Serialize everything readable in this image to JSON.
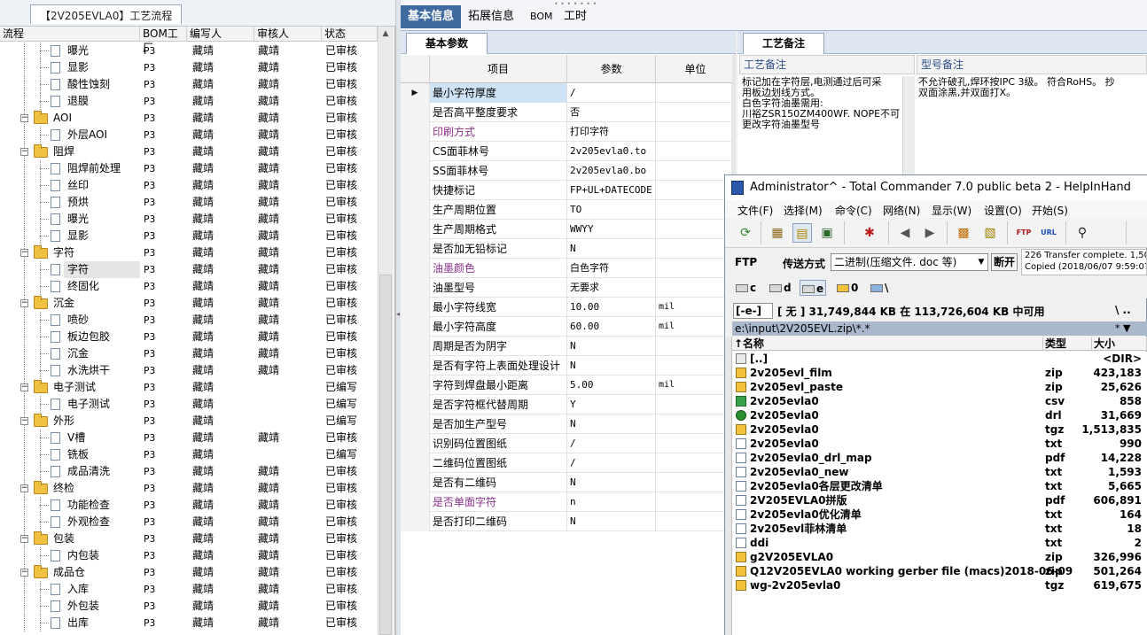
{
  "left": {
    "title": "【2V205EVLA0】工艺流程",
    "columns": [
      "流程",
      "BOM工厂",
      "编写人",
      "审核人",
      "状态"
    ],
    "rows": [
      {
        "name": "曝光",
        "level": 2,
        "kind": "doc",
        "bom": "P3",
        "editor": "藏靖",
        "reviewer": "藏靖",
        "status": "已审核"
      },
      {
        "name": "显影",
        "level": 2,
        "kind": "doc",
        "bom": "P3",
        "editor": "藏靖",
        "reviewer": "藏靖",
        "status": "已审核"
      },
      {
        "name": "酸性蚀刻",
        "level": 2,
        "kind": "doc",
        "bom": "P3",
        "editor": "藏靖",
        "reviewer": "藏靖",
        "status": "已审核"
      },
      {
        "name": "退膜",
        "level": 2,
        "kind": "doc",
        "bom": "P3",
        "editor": "藏靖",
        "reviewer": "藏靖",
        "status": "已审核"
      },
      {
        "name": "AOI",
        "level": 1,
        "kind": "folder",
        "bom": "P3",
        "editor": "藏靖",
        "reviewer": "藏靖",
        "status": "已审核"
      },
      {
        "name": "外层AOI",
        "level": 2,
        "kind": "doc",
        "bom": "P3",
        "editor": "藏靖",
        "reviewer": "藏靖",
        "status": "已审核"
      },
      {
        "name": "阻焊",
        "level": 1,
        "kind": "folder",
        "bom": "P3",
        "editor": "藏靖",
        "reviewer": "藏靖",
        "status": "已审核"
      },
      {
        "name": "阻焊前处理",
        "level": 2,
        "kind": "doc",
        "bom": "P3",
        "editor": "藏靖",
        "reviewer": "藏靖",
        "status": "已审核"
      },
      {
        "name": "丝印",
        "level": 2,
        "kind": "doc",
        "bom": "P3",
        "editor": "藏靖",
        "reviewer": "藏靖",
        "status": "已审核"
      },
      {
        "name": "预烘",
        "level": 2,
        "kind": "doc",
        "bom": "P3",
        "editor": "藏靖",
        "reviewer": "藏靖",
        "status": "已审核"
      },
      {
        "name": "曝光",
        "level": 2,
        "kind": "doc",
        "bom": "P3",
        "editor": "藏靖",
        "reviewer": "藏靖",
        "status": "已审核"
      },
      {
        "name": "显影",
        "level": 2,
        "kind": "doc",
        "bom": "P3",
        "editor": "藏靖",
        "reviewer": "藏靖",
        "status": "已审核"
      },
      {
        "name": "字符",
        "level": 1,
        "kind": "folder",
        "bom": "P3",
        "editor": "藏靖",
        "reviewer": "藏靖",
        "status": "已审核"
      },
      {
        "name": "字符",
        "level": 2,
        "kind": "doc",
        "bom": "P3",
        "editor": "藏靖",
        "reviewer": "藏靖",
        "status": "已审核",
        "selected": true
      },
      {
        "name": "终固化",
        "level": 2,
        "kind": "doc",
        "bom": "P3",
        "editor": "藏靖",
        "reviewer": "藏靖",
        "status": "已审核"
      },
      {
        "name": "沉金",
        "level": 1,
        "kind": "folder",
        "bom": "P3",
        "editor": "藏靖",
        "reviewer": "藏靖",
        "status": "已审核"
      },
      {
        "name": "喷砂",
        "level": 2,
        "kind": "doc",
        "bom": "P3",
        "editor": "藏靖",
        "reviewer": "藏靖",
        "status": "已审核"
      },
      {
        "name": "板边包胶",
        "level": 2,
        "kind": "doc",
        "bom": "P3",
        "editor": "藏靖",
        "reviewer": "藏靖",
        "status": "已审核"
      },
      {
        "name": "沉金",
        "level": 2,
        "kind": "doc",
        "bom": "P3",
        "editor": "藏靖",
        "reviewer": "藏靖",
        "status": "已审核"
      },
      {
        "name": "水洗烘干",
        "level": 2,
        "kind": "doc",
        "bom": "P3",
        "editor": "藏靖",
        "reviewer": "藏靖",
        "status": "已审核"
      },
      {
        "name": "电子测试",
        "level": 1,
        "kind": "folder",
        "bom": "P3",
        "editor": "藏靖",
        "reviewer": "",
        "status": "已编写"
      },
      {
        "name": "电子测试",
        "level": 2,
        "kind": "doc",
        "bom": "P3",
        "editor": "藏靖",
        "reviewer": "",
        "status": "已编写"
      },
      {
        "name": "外形",
        "level": 1,
        "kind": "folder",
        "bom": "P3",
        "editor": "藏靖",
        "reviewer": "",
        "status": "已编写"
      },
      {
        "name": "V槽",
        "level": 2,
        "kind": "doc",
        "bom": "P3",
        "editor": "藏靖",
        "reviewer": "藏靖",
        "status": "已审核"
      },
      {
        "name": "铣板",
        "level": 2,
        "kind": "doc",
        "bom": "P3",
        "editor": "藏靖",
        "reviewer": "",
        "status": "已编写"
      },
      {
        "name": "成品清洗",
        "level": 2,
        "kind": "doc",
        "bom": "P3",
        "editor": "藏靖",
        "reviewer": "藏靖",
        "status": "已审核"
      },
      {
        "name": "终检",
        "level": 1,
        "kind": "folder",
        "bom": "P3",
        "editor": "藏靖",
        "reviewer": "藏靖",
        "status": "已审核"
      },
      {
        "name": "功能检查",
        "level": 2,
        "kind": "doc",
        "bom": "P3",
        "editor": "藏靖",
        "reviewer": "藏靖",
        "status": "已审核"
      },
      {
        "name": "外观检查",
        "level": 2,
        "kind": "doc",
        "bom": "P3",
        "editor": "藏靖",
        "reviewer": "藏靖",
        "status": "已审核"
      },
      {
        "name": "包装",
        "level": 1,
        "kind": "folder",
        "bom": "P3",
        "editor": "藏靖",
        "reviewer": "藏靖",
        "status": "已审核"
      },
      {
        "name": "内包装",
        "level": 2,
        "kind": "doc",
        "bom": "P3",
        "editor": "藏靖",
        "reviewer": "藏靖",
        "status": "已审核"
      },
      {
        "name": "成品仓",
        "level": 1,
        "kind": "folder",
        "bom": "P3",
        "editor": "藏靖",
        "reviewer": "藏靖",
        "status": "已审核"
      },
      {
        "name": "入库",
        "level": 2,
        "kind": "doc",
        "bom": "P3",
        "editor": "藏靖",
        "reviewer": "藏靖",
        "status": "已审核"
      },
      {
        "name": "外包装",
        "level": 2,
        "kind": "doc",
        "bom": "P3",
        "editor": "藏靖",
        "reviewer": "藏靖",
        "status": "已审核"
      },
      {
        "name": "出库",
        "level": 2,
        "kind": "doc",
        "bom": "P3",
        "editor": "藏靖",
        "reviewer": "藏靖",
        "status": "已审核"
      }
    ]
  },
  "tabs": [
    "基本信息",
    "拓展信息",
    "BOM",
    "工时"
  ],
  "mid": {
    "subtab": "基本参数",
    "columns": [
      "项目",
      "参数",
      "单位"
    ],
    "rows": [
      {
        "item": "最小字符厚度",
        "param": "/",
        "unit": "",
        "purple": false,
        "selected": true
      },
      {
        "item": "是否高平整度要求",
        "param": "否",
        "unit": "",
        "purple": false
      },
      {
        "item": "印刷方式",
        "param": "打印字符",
        "unit": "",
        "purple": true
      },
      {
        "item": "CS面菲林号",
        "param": "2v205evla0.to",
        "unit": "",
        "purple": false
      },
      {
        "item": "SS面菲林号",
        "param": "2v205evla0.bo",
        "unit": "",
        "purple": false
      },
      {
        "item": "快捷标记",
        "param": "FP+UL+DATECODE",
        "unit": "",
        "purple": false
      },
      {
        "item": "生产周期位置",
        "param": "TO",
        "unit": "",
        "purple": false
      },
      {
        "item": "生产周期格式",
        "param": "WWYY",
        "unit": "",
        "purple": false
      },
      {
        "item": "是否加无铅标记",
        "param": "N",
        "unit": "",
        "purple": false
      },
      {
        "item": "油墨颜色",
        "param": "白色字符",
        "unit": "",
        "purple": true
      },
      {
        "item": "油墨型号",
        "param": "无要求",
        "unit": "",
        "purple": false
      },
      {
        "item": "最小字符线宽",
        "param": "10.00",
        "unit": "mil",
        "purple": false
      },
      {
        "item": "最小字符高度",
        "param": "60.00",
        "unit": "mil",
        "purple": false
      },
      {
        "item": "周期是否为阴字",
        "param": "N",
        "unit": "",
        "purple": false
      },
      {
        "item": "是否有字符上表面处理设计",
        "param": "N",
        "unit": "",
        "purple": false
      },
      {
        "item": "字符到焊盘最小距离",
        "param": "5.00",
        "unit": "mil",
        "purple": false
      },
      {
        "item": "是否字符框代替周期",
        "param": "Y",
        "unit": "",
        "purple": false
      },
      {
        "item": "是否加生产型号",
        "param": "N",
        "unit": "",
        "purple": false
      },
      {
        "item": "识别码位置图纸",
        "param": "/",
        "unit": "",
        "purple": false
      },
      {
        "item": "二维码位置图纸",
        "param": "/",
        "unit": "",
        "purple": false
      },
      {
        "item": "是否有二维码",
        "param": "N",
        "unit": "",
        "purple": false
      },
      {
        "item": "是否单面字符",
        "param": "n",
        "unit": "",
        "purple": true
      },
      {
        "item": "是否打印二维码",
        "param": "N",
        "unit": "",
        "purple": false
      }
    ]
  },
  "right": {
    "subtab": "工艺备注",
    "col1": "工艺备注",
    "col2": "型号备注",
    "note1": [
      "标记加在字符层,电测通过后可采",
      "用板边划线方式。",
      "白色字符油墨需用:",
      "川裕ZSR150ZM400WF.  NOPE不可",
      "更改字符油墨型号"
    ],
    "note2": [
      "不允许破孔,焊环按IPC 3级。   符合RoHS。   抄",
      "双面涂黑,并双面打X。"
    ]
  },
  "tc": {
    "title": "Administrator^ - Total Commander 7.0 public beta 2 - HelpInHand",
    "menu": [
      "文件(F)",
      "选择(M)",
      "命令(C)",
      "网络(N)",
      "显示(W)",
      "设置(O)",
      "开始(S)"
    ],
    "ftp_label": "FTP",
    "transfer_label": "传送方式",
    "transfer_mode": "二进制(压缩文件. doc 等)",
    "disconnect": "断开",
    "log": [
      "226 Transfer complete. 1,509",
      "Copied (2018/06/07 9:59:07)"
    ],
    "drives": [
      "c",
      "d",
      "e",
      "0",
      "\\"
    ],
    "drive_select": "[-e-]",
    "free_space": "[ 无 ]  31,749,844 KB 在 113,726,604 KB 中可用",
    "path_buttons": "\\  ..",
    "path": "e:\\input\\2V205EVL.zip\\*.*",
    "path_right": "*  ▼",
    "list_cols": [
      "↑名称",
      "类型",
      "大小"
    ],
    "files": [
      {
        "name": "[..]",
        "type": "",
        "size": "<DIR>",
        "icon": "up"
      },
      {
        "name": "2v205evl_film",
        "type": "zip",
        "size": "423,183",
        "icon": "zip"
      },
      {
        "name": "2v205evl_paste",
        "type": "zip",
        "size": "25,626",
        "icon": "zip"
      },
      {
        "name": "2v205evla0",
        "type": "csv",
        "size": "858",
        "icon": "csv"
      },
      {
        "name": "2v205evla0",
        "type": "drl",
        "size": "31,669",
        "icon": "drl"
      },
      {
        "name": "2v205evla0",
        "type": "tgz",
        "size": "1,513,835",
        "icon": "tgz"
      },
      {
        "name": "2v205evla0",
        "type": "txt",
        "size": "990",
        "icon": "txt"
      },
      {
        "name": "2v205evla0_drl_map",
        "type": "pdf",
        "size": "14,228",
        "icon": "pdf"
      },
      {
        "name": "2v205evla0_new",
        "type": "txt",
        "size": "1,593",
        "icon": "txt"
      },
      {
        "name": "2v205evla0各层更改清单",
        "type": "txt",
        "size": "5,665",
        "icon": "txt"
      },
      {
        "name": "2V205EVLA0拼版",
        "type": "pdf",
        "size": "606,891",
        "icon": "pdf"
      },
      {
        "name": "2v205evla0优化清单",
        "type": "txt",
        "size": "164",
        "icon": "txt"
      },
      {
        "name": "2v205evl菲林清单",
        "type": "txt",
        "size": "18",
        "icon": "txt"
      },
      {
        "name": "ddi",
        "type": "txt",
        "size": "2",
        "icon": "txt"
      },
      {
        "name": "g2V205EVLA0",
        "type": "zip",
        "size": "326,996",
        "icon": "zip"
      },
      {
        "name": "Q12V205EVLA0 working gerber file (macs)2018-06-09",
        "type": "zip",
        "size": "501,264",
        "icon": "zip"
      },
      {
        "name": "wg-2v205evla0",
        "type": "tgz",
        "size": "619,675",
        "icon": "tgz"
      }
    ]
  }
}
